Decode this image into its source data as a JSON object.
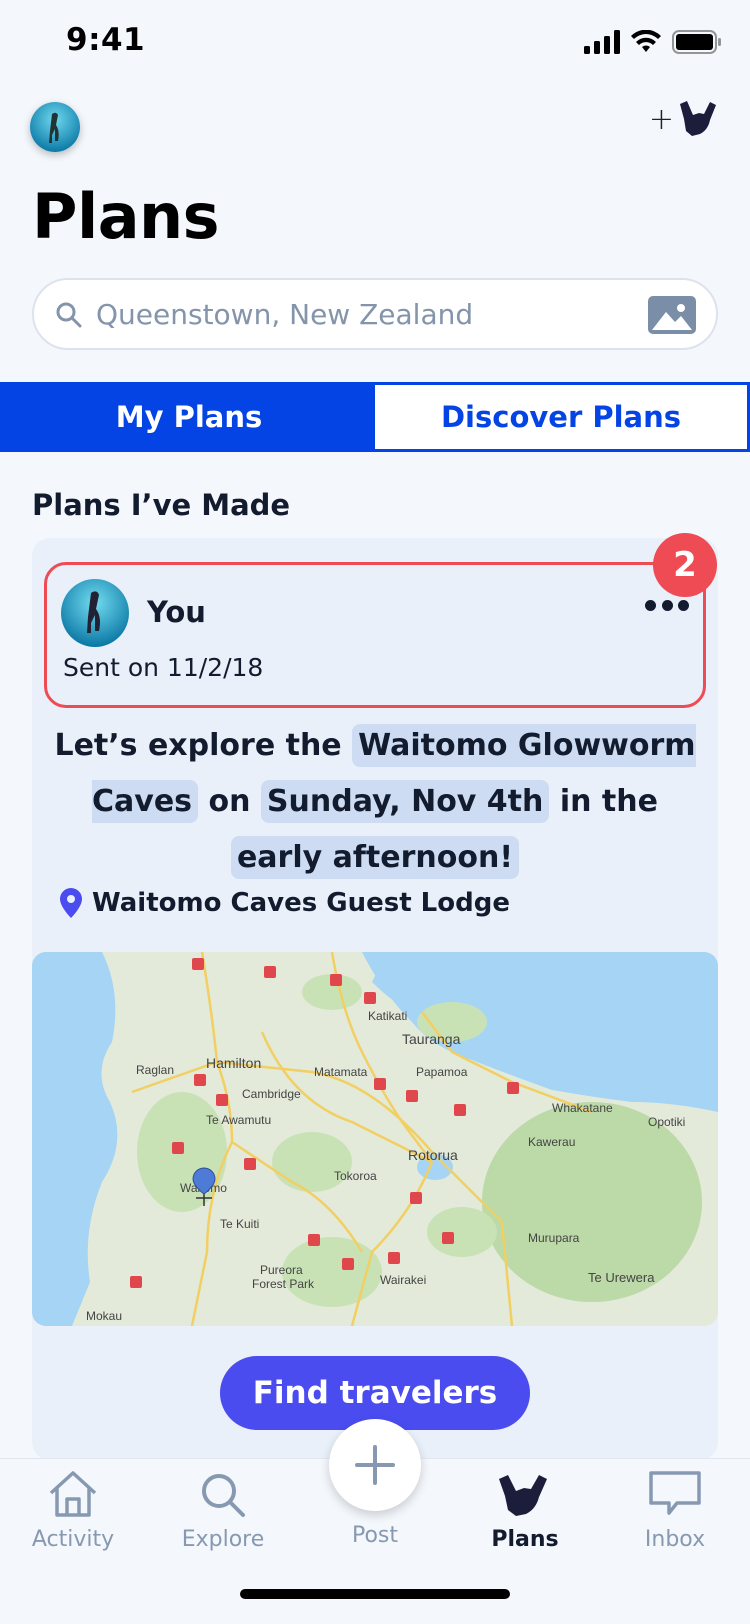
{
  "status": {
    "time": "9:41"
  },
  "header": {
    "title": "Plans"
  },
  "search": {
    "placeholder": "Queenstown, New Zealand"
  },
  "tabs": [
    {
      "label": "My Plans",
      "active": true
    },
    {
      "label": "Discover Plans",
      "active": false
    }
  ],
  "section": {
    "title": "Plans I’ve Made"
  },
  "plan": {
    "badge_count": "2",
    "sender": "You",
    "sent_date": "Sent on 11/2/18",
    "text": {
      "p1": "Let’s explore the",
      "place": "Waitomo Glowworm Caves",
      "p2": "on",
      "date": "Sunday, Nov 4th",
      "p3": "in the",
      "time": "early afternoon!"
    },
    "location": "Waitomo Caves Guest Lodge",
    "button": "Find travelers"
  },
  "map_labels": {
    "hamilton": "Hamilton",
    "tauranga": "Tauranga",
    "raglan": "Raglan",
    "matamata": "Matamata",
    "papamoa": "Papamoa",
    "katikati": "Katikati",
    "cambridge": "Cambridge",
    "te_awamutu": "Te Awamutu",
    "whakatane": "Whakatane",
    "opotiki": "Opotiki",
    "kawerau": "Kawerau",
    "rotorua": "Rotorua",
    "tokoroa": "Tokoroa",
    "waitomo": "Waitomo",
    "te_kuiti": "Te Kuiti",
    "murupara": "Murupara",
    "pureora": "Pureora",
    "forest_park": "Forest Park",
    "wairakei": "Wairakei",
    "te_urewera": "Te Urewera",
    "mokau": "Mokau"
  },
  "nav": [
    {
      "label": "Activity",
      "icon": "home-icon"
    },
    {
      "label": "Explore",
      "icon": "search-icon"
    },
    {
      "label": "Post",
      "icon": "plus-icon"
    },
    {
      "label": "Plans",
      "icon": "shaka-icon",
      "active": true
    },
    {
      "label": "Inbox",
      "icon": "chat-bubble-icon"
    }
  ],
  "colors": {
    "primary": "#0544e4",
    "button": "#4b4cf0",
    "alert": "#ee4b54",
    "card": "#e9f0f9"
  }
}
